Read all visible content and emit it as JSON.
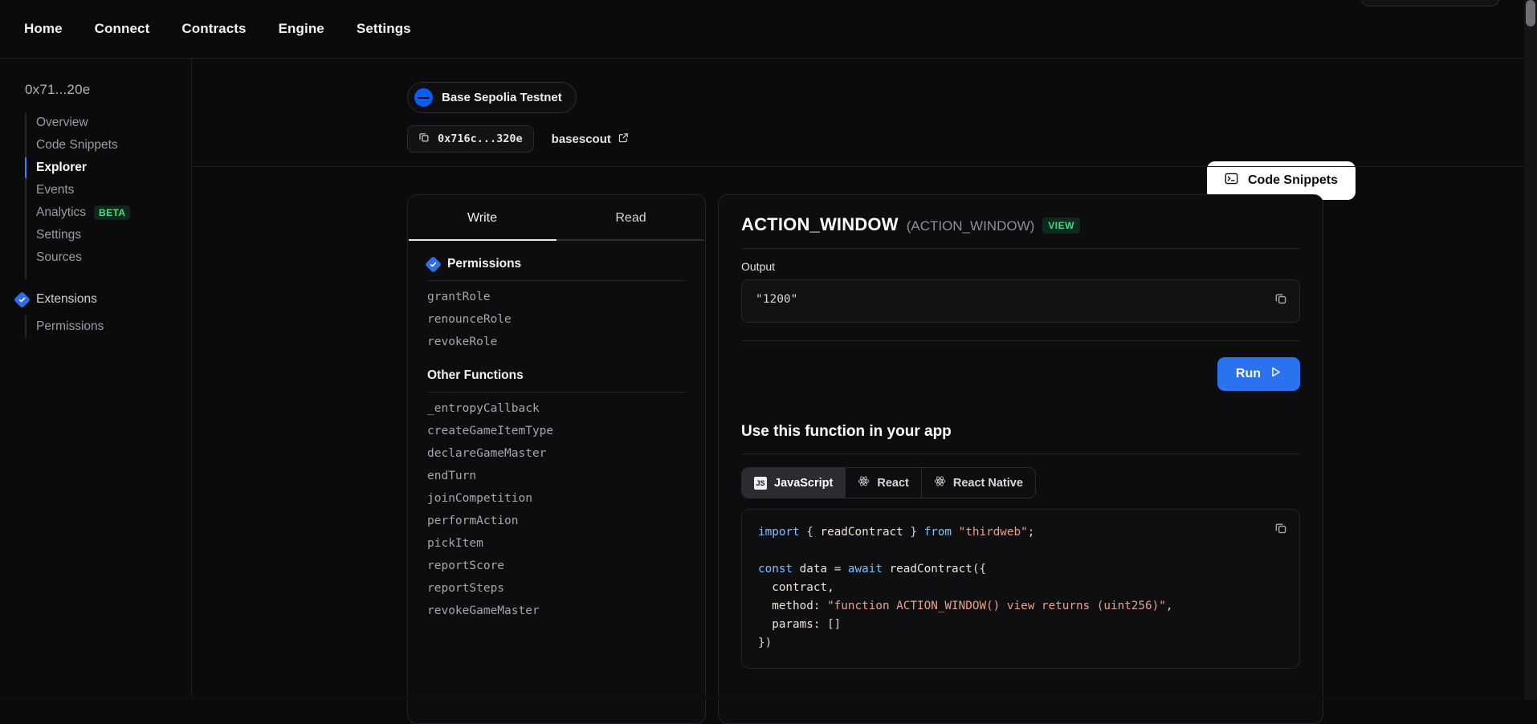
{
  "topnav": {
    "items": [
      {
        "label": "Home"
      },
      {
        "label": "Connect"
      },
      {
        "label": "Contracts"
      },
      {
        "label": "Engine"
      },
      {
        "label": "Settings"
      }
    ]
  },
  "sidebar": {
    "address": "0x71...20e",
    "items": [
      {
        "label": "Overview",
        "active": false
      },
      {
        "label": "Code Snippets",
        "active": false
      },
      {
        "label": "Explorer",
        "active": true
      },
      {
        "label": "Events",
        "active": false
      },
      {
        "label": "Analytics",
        "active": false,
        "badge": "BETA"
      },
      {
        "label": "Settings",
        "active": false
      },
      {
        "label": "Sources",
        "active": false
      }
    ],
    "extensions": {
      "label": "Extensions",
      "icon": "blue-diamond-check-icon",
      "children": [
        {
          "label": "Permissions"
        }
      ]
    }
  },
  "header": {
    "network": {
      "name": "Base Sepolia Testnet",
      "icon": "base-logo-icon"
    },
    "address_chip": {
      "value": "0x716c...320e",
      "icon": "copy-icon"
    },
    "explorer_link": {
      "label": "basescout",
      "icon": "external-link-icon"
    },
    "code_snippets_button": {
      "label": "Code Snippets",
      "icon": "terminal-icon"
    }
  },
  "left_panel": {
    "tabs": [
      {
        "label": "Write",
        "active": true
      },
      {
        "label": "Read",
        "active": false
      }
    ],
    "sections": [
      {
        "title": "Permissions",
        "icon": "blue-diamond-check-icon",
        "functions": [
          "grantRole",
          "renounceRole",
          "revokeRole"
        ]
      },
      {
        "title": "Other Functions",
        "icon": null,
        "functions": [
          "_entropyCallback",
          "createGameItemType",
          "declareGameMaster",
          "endTurn",
          "joinCompetition",
          "performAction",
          "pickItem",
          "reportScore",
          "reportSteps",
          "revokeGameMaster"
        ]
      }
    ]
  },
  "right_panel": {
    "function_name": "ACTION_WINDOW",
    "function_signature": "(ACTION_WINDOW)",
    "state_badge": "VIEW",
    "output_label": "Output",
    "output_value": "\"1200\"",
    "copy_icon": "copy-icon",
    "run_button": {
      "label": "Run",
      "icon": "play-icon"
    },
    "use_title": "Use this function in your app",
    "lang_tabs": [
      {
        "label": "JavaScript",
        "icon": "js-icon",
        "active": true
      },
      {
        "label": "React",
        "icon": "react-icon",
        "active": false
      },
      {
        "label": "React Native",
        "icon": "react-icon",
        "active": false
      }
    ],
    "code_copy_icon": "copy-icon",
    "code_lines": [
      [
        {
          "t": "import ",
          "c": "k-kw"
        },
        {
          "t": "{ ",
          "c": "k-pl"
        },
        {
          "t": "readContract",
          "c": "k-id"
        },
        {
          "t": " } ",
          "c": "k-pl"
        },
        {
          "t": "from ",
          "c": "k-kw"
        },
        {
          "t": "\"thirdweb\"",
          "c": "k-str"
        },
        {
          "t": ";",
          "c": "k-pl"
        }
      ],
      [],
      [
        {
          "t": "const ",
          "c": "k-kw"
        },
        {
          "t": "data ",
          "c": "k-id"
        },
        {
          "t": "= ",
          "c": "k-pl"
        },
        {
          "t": "await ",
          "c": "k-kw"
        },
        {
          "t": "readContract",
          "c": "k-id"
        },
        {
          "t": "({",
          "c": "k-pl"
        }
      ],
      [
        {
          "t": "  contract,",
          "c": "k-id"
        }
      ],
      [
        {
          "t": "  method: ",
          "c": "k-id"
        },
        {
          "t": "\"function ACTION_WINDOW() view returns (uint256)\"",
          "c": "k-str"
        },
        {
          "t": ",",
          "c": "k-pl"
        }
      ],
      [
        {
          "t": "  params: ",
          "c": "k-id"
        },
        {
          "t": "[]",
          "c": "k-pl"
        }
      ],
      [
        {
          "t": "})",
          "c": "k-pl"
        }
      ]
    ]
  },
  "colors": {
    "accent_blue": "#2a72f0",
    "active_indicator": "#3b82f6",
    "badge_green": "#3ddc84",
    "page_bg": "#0b0b0d",
    "card_bg": "#0d0d10",
    "border": "#232328"
  }
}
